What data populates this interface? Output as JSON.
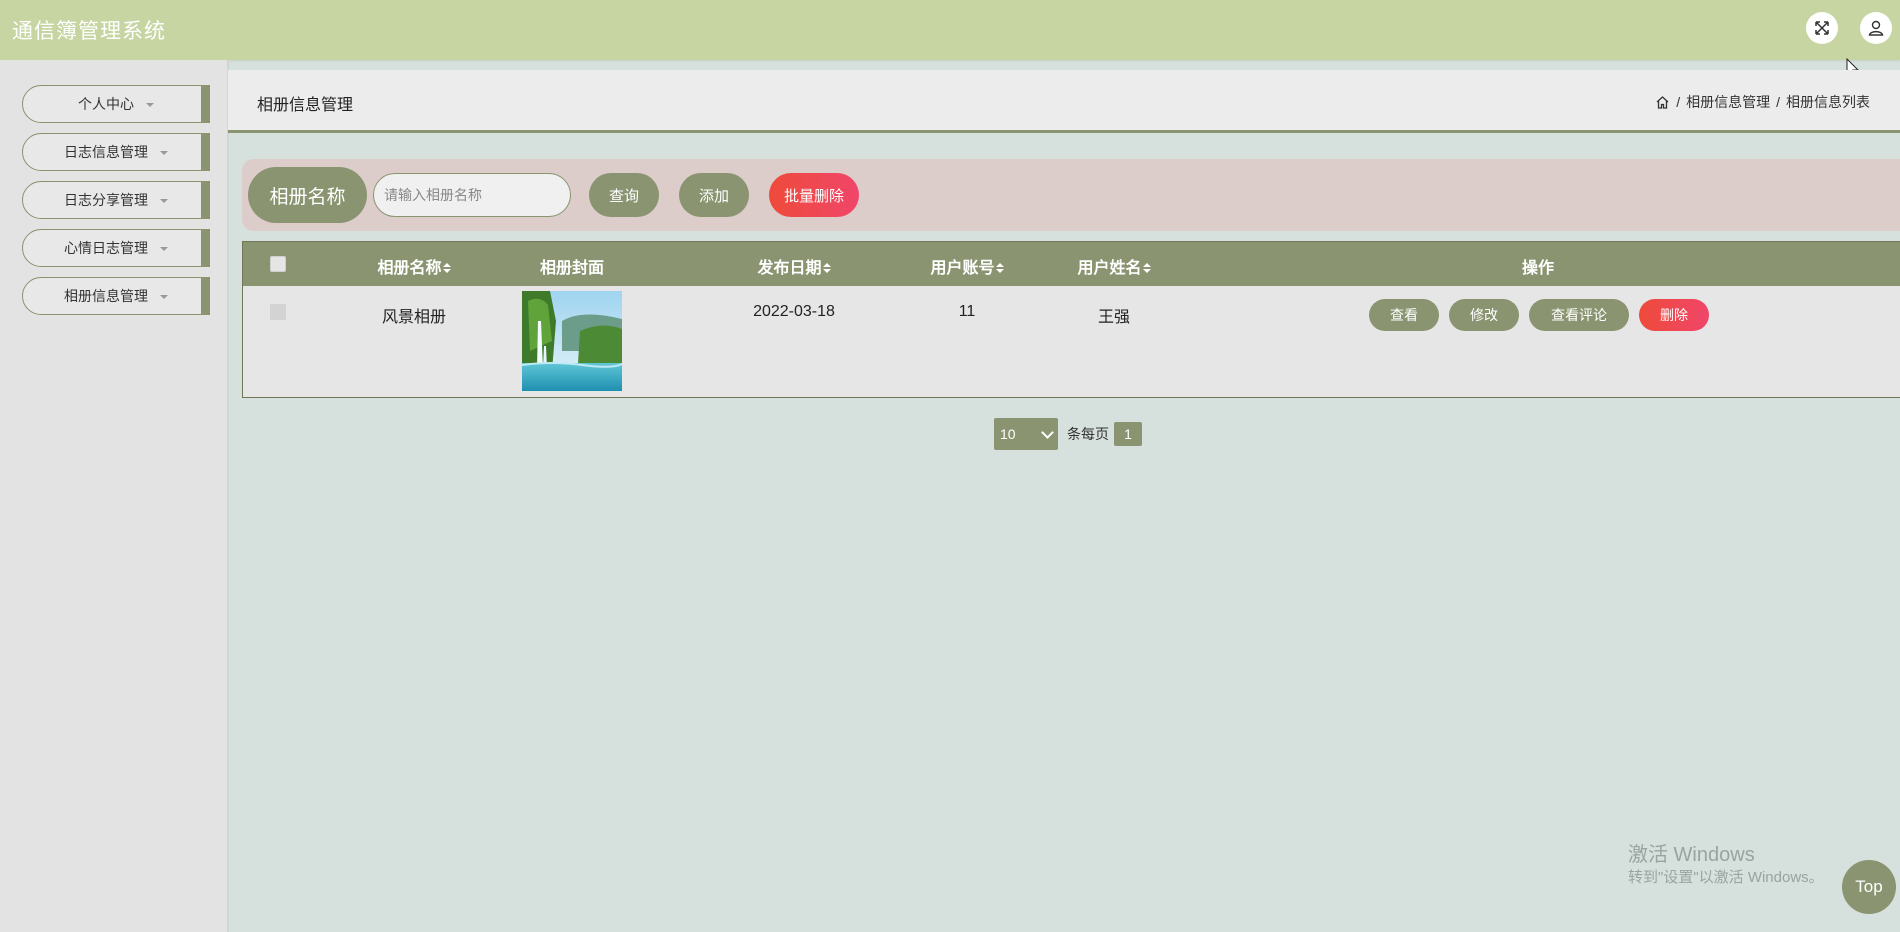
{
  "app": {
    "title": "通信簿管理系统"
  },
  "header": {
    "fullscreen_icon": "expand-icon",
    "user_icon": "user-icon"
  },
  "sidebar": {
    "items": [
      {
        "label": "个人中心"
      },
      {
        "label": "日志信息管理"
      },
      {
        "label": "日志分享管理"
      },
      {
        "label": "心情日志管理"
      },
      {
        "label": "相册信息管理"
      }
    ]
  },
  "page": {
    "title": "相册信息管理",
    "breadcrumb": [
      "相册信息管理",
      "相册信息列表"
    ],
    "breadcrumb_sep": "/"
  },
  "search": {
    "label": "相册名称",
    "placeholder": "请输入相册名称",
    "value": "",
    "query_button": "查询",
    "add_button": "添加",
    "batch_delete_button": "批量删除"
  },
  "table": {
    "headers": {
      "name": "相册名称",
      "cover": "相册封面",
      "date": "发布日期",
      "account": "用户账号",
      "username": "用户姓名",
      "actions": "操作"
    },
    "rows": [
      {
        "name": "风景相册",
        "cover": "landscape-waterfall-image",
        "date": "2022-03-18",
        "account": "11",
        "username": "王强",
        "actions": {
          "view": "查看",
          "edit": "修改",
          "comments": "查看评论",
          "delete": "删除"
        }
      }
    ]
  },
  "pagination": {
    "page_size": "10",
    "per_page_label": "条每页",
    "current_page": "1"
  },
  "watermark": {
    "line1": "激活 Windows",
    "line2": "转到\"设置\"以激活 Windows。"
  },
  "back_to_top": "Top",
  "colors": {
    "accent": "#8a9470",
    "header": "#c6d5a2",
    "danger": "#ee4a3a",
    "background": "#d6e0dc"
  }
}
